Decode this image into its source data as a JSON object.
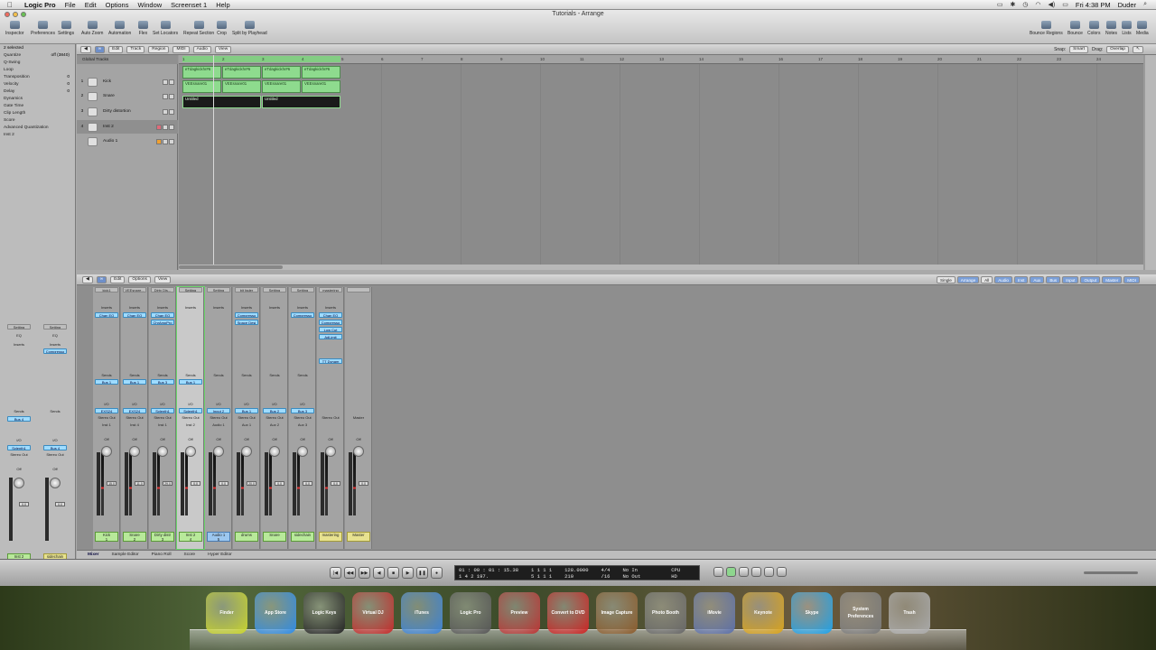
{
  "menubar": {
    "app": "Logic Pro",
    "items": [
      "File",
      "Edit",
      "Options",
      "Window",
      "Screenset 1",
      "Help"
    ],
    "clock": "Fri 4:38 PM",
    "user": "Duder"
  },
  "window": {
    "title": "Tutorials - Arrange",
    "toolbar_left": [
      "Inspector",
      "Preferences",
      "Settings",
      "Auto Zoom",
      "Automation",
      "Flex",
      "Set Locators",
      "Repeat Section",
      "Crop",
      "Split by Playhead"
    ],
    "toolbar_right": [
      "Bounce Regions",
      "Bounce",
      "Colors",
      "Notes",
      "Lists",
      "Media"
    ]
  },
  "inspector": {
    "header": "2 selected",
    "params": [
      {
        "label": "Quantize",
        "value": "off (3840)"
      },
      {
        "label": "Q-Swing",
        "value": ""
      },
      {
        "label": "Loop",
        "value": ""
      },
      {
        "label": "Transposition",
        "value": "0"
      },
      {
        "label": "Velocity",
        "value": "0"
      },
      {
        "label": "Delay",
        "value": "0"
      },
      {
        "label": "Dynamics",
        "value": ""
      },
      {
        "label": "Gate Time",
        "value": ""
      },
      {
        "label": "Clip Length",
        "value": ""
      },
      {
        "label": "Score",
        "value": ""
      }
    ],
    "advanced": "Advanced Quantization",
    "track_section": "Inst 2",
    "strip1": {
      "setting": "Setting",
      "eq": "EQ",
      "inserts": "Inserts",
      "sends": "Sends",
      "send1": "Bus 4",
      "io": "I/O",
      "input": "Sylenth1",
      "output": "Stereo Out",
      "auto": "Off",
      "gain": "0.0",
      "name": "Inst 2"
    },
    "strip2": {
      "setting": "Setting",
      "eq": "EQ",
      "inserts": "Inserts",
      "insert1": "Compresso",
      "sends": "Sends",
      "io": "I/O",
      "input": "Bus 4",
      "output": "Stereo Out",
      "auto": "Off",
      "gain": "0.0",
      "name": "sidechain"
    }
  },
  "arrange": {
    "toolbar": [
      "Edit",
      "Track",
      "Region",
      "MIDI",
      "Audio",
      "View"
    ],
    "snap_label": "Snap:",
    "snap_value": "Smart",
    "drag_label": "Drag:",
    "drag_value": "Overlap",
    "global_tracks": "Global Tracks",
    "tracks": [
      {
        "num": "1",
        "name": "Kick"
      },
      {
        "num": "2",
        "name": "Snare"
      },
      {
        "num": "3",
        "name": "Dirty distortion"
      },
      {
        "num": "4",
        "name": "Inst 2"
      },
      {
        "num": "5",
        "name": "Audio 1"
      }
    ],
    "bars": [
      "1",
      "2",
      "3",
      "4",
      "5",
      "6",
      "7",
      "8",
      "9",
      "10",
      "11",
      "12",
      "13",
      "14",
      "15",
      "16",
      "17",
      "18",
      "19",
      "20",
      "21",
      "22",
      "23",
      "24"
    ],
    "regions": {
      "kick": "eTdagkickhr#6",
      "snare": "VEEsnare01",
      "dirty": "Untitled"
    }
  },
  "mixer": {
    "toolbar": [
      "Edit",
      "Options",
      "View"
    ],
    "filter_views": [
      "Single",
      "Arrange",
      "All"
    ],
    "filter_types": [
      "Audio",
      "Inst",
      "Aux",
      "Bus",
      "Input",
      "Output",
      "Master",
      "MIDI"
    ],
    "strips": [
      {
        "setting": "kick1",
        "inserts": "Inserts",
        "ins": [
          "Chan EQ"
        ],
        "sends": "Sends",
        "send": "Bus 1",
        "io": "I/O",
        "input": "EXS24",
        "output": "Stereo Out",
        "outname": "Inst 1",
        "auto": "Off",
        "val": "15.0",
        "name": "Kick",
        "num": "1"
      },
      {
        "setting": "VEEsnare...",
        "inserts": "Inserts",
        "ins": [
          "Chan EQ"
        ],
        "sends": "Sends",
        "send": "Bus 1",
        "io": "I/O",
        "input": "EXS24",
        "output": "Stereo Out",
        "outname": "Inst 4",
        "auto": "Off",
        "val": "11.0",
        "name": "Snare",
        "num": "2"
      },
      {
        "setting": "Dirty Dis...",
        "inserts": "Inserts",
        "ins": [
          "Chan EQ",
          "ChrAmpPro"
        ],
        "sends": "Sends",
        "send": "Bus 3",
        "io": "I/O",
        "input": "Sylenth1",
        "output": "Stereo Out",
        "outname": "Inst 1",
        "auto": "Off",
        "val": "29.0",
        "name": "Dirty distr",
        "num": "3"
      },
      {
        "setting": "Setting",
        "inserts": "Inserts",
        "ins": [],
        "sends": "Sends",
        "send": "Bus 1",
        "io": "I/O",
        "input": "Sylenth1",
        "output": "Stereo Out",
        "outname": "Inst 2",
        "auto": "Off",
        "val": "0.0",
        "name": "Inst 2",
        "num": "4"
      },
      {
        "setting": "Setting",
        "inserts": "Inserts",
        "ins": [],
        "sends": "Sends",
        "send": "",
        "io": "I/O",
        "input": "Input 2",
        "output": "Stereo Out",
        "outname": "Audio 1",
        "auto": "Off",
        "val": "0.0",
        "name": "Audio 1",
        "num": "5"
      },
      {
        "setting": "bit fader",
        "inserts": "Inserts",
        "ins": [
          "Compresso",
          "Space Desi"
        ],
        "sends": "Sends",
        "send": "",
        "io": "I/O",
        "input": "Bus 1",
        "output": "Stereo Out",
        "outname": "Aux 1",
        "auto": "Off",
        "val": "20.0",
        "name": "drums",
        "num": ""
      },
      {
        "setting": "Setting",
        "inserts": "Inserts",
        "ins": [],
        "sends": "Sends",
        "send": "",
        "io": "I/O",
        "input": "Bus 2",
        "output": "Stereo Out",
        "outname": "Aux 2",
        "auto": "Off",
        "val": "0.0",
        "name": "Snare",
        "num": ""
      },
      {
        "setting": "Setting",
        "inserts": "Inserts",
        "ins": [
          "Compresso"
        ],
        "sends": "Sends",
        "send": "",
        "io": "I/O",
        "input": "Bus 3",
        "output": "Stereo Out",
        "outname": "Aux 3",
        "auto": "Off",
        "val": "0.0",
        "name": "sidechain",
        "num": ""
      },
      {
        "setting": "mastering",
        "inserts": "Inserts",
        "ins": [
          "Chan EQ",
          "Compresso",
          "Low Cut",
          "AdLimit",
          "TT Dynam"
        ],
        "sends": "",
        "send": "",
        "io": "",
        "input": "",
        "output": "Stereo Out",
        "outname": "",
        "auto": "Off",
        "val": "0.0",
        "name": "mastering",
        "num": ""
      },
      {
        "setting": "",
        "inserts": "",
        "ins": [],
        "sends": "",
        "send": "",
        "io": "",
        "input": "",
        "output": "Master",
        "outname": "",
        "auto": "Off",
        "val": "0.0",
        "name": "Master",
        "num": ""
      }
    ]
  },
  "bottom_tabs": [
    "Mixer",
    "Sample Editor",
    "Piano Roll",
    "Score",
    "Hyper Editor"
  ],
  "transport": {
    "time": "01 : 00 : 01 : 15.38",
    "bars": "1  4  2  197.",
    "pos_left": "1   1   1   1",
    "pos_right": "5   1   1   1",
    "tempo": "128.0000",
    "ticks": "210",
    "sig": "4/4",
    "div": "/16",
    "in": "No In",
    "out": "No Out",
    "cpu": "CPU",
    "hd": "HD"
  },
  "dock": [
    "Finder",
    "App Store",
    "Logic Keys",
    "Virtual DJ",
    "iTunes",
    "Logic Pro",
    "Preview",
    "Convert to DVD",
    "Image Capture",
    "Photo Booth",
    "iMovie",
    "Keynote",
    "Skype",
    "System Preferences",
    "Trash"
  ]
}
